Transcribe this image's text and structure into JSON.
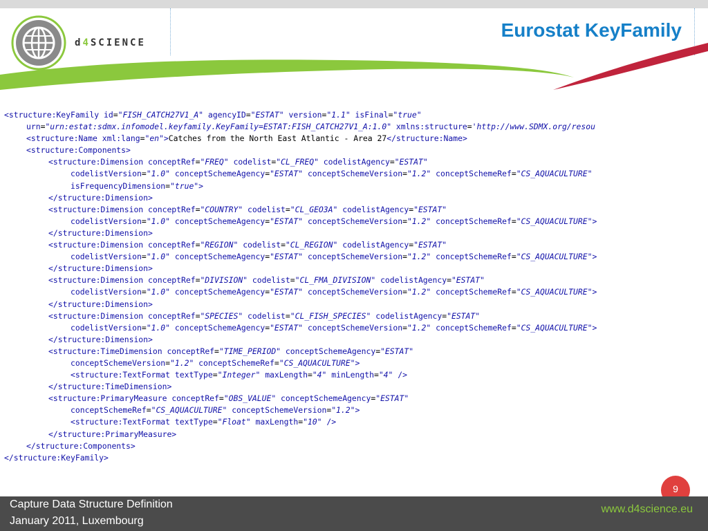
{
  "header": {
    "title": "Eurostat KeyFamily",
    "logo_prefix": "d",
    "logo_digit": "4",
    "logo_suffix": "SCIENCE"
  },
  "code_lines": [
    {
      "indent": 0,
      "tokens": [
        [
          "tg",
          "<structure:KeyFamily"
        ],
        [
          "tx",
          " "
        ],
        [
          "at",
          "id"
        ],
        [
          "eq",
          "="
        ],
        [
          "vl",
          "\"FISH_CATCH27V1_A\""
        ],
        [
          "tx",
          " "
        ],
        [
          "at",
          "agencyID"
        ],
        [
          "eq",
          "="
        ],
        [
          "vl",
          "\"ESTAT\""
        ],
        [
          "tx",
          " "
        ],
        [
          "at",
          "version"
        ],
        [
          "eq",
          "="
        ],
        [
          "vl",
          "\"1.1\""
        ],
        [
          "tx",
          " "
        ],
        [
          "at",
          "isFinal"
        ],
        [
          "eq",
          "="
        ],
        [
          "vl",
          "\"true\""
        ]
      ]
    },
    {
      "indent": 1,
      "tokens": [
        [
          "at",
          "urn"
        ],
        [
          "eq",
          "="
        ],
        [
          "vl",
          "\"urn:estat:sdmx.infomodel.keyfamily.KeyFamily=ESTAT:FISH_CATCH27V1_A:1.0\""
        ],
        [
          "tx",
          " "
        ],
        [
          "at",
          "xmlns:structure"
        ],
        [
          "eq",
          "="
        ],
        [
          "vl",
          "'http://www.SDMX.org/resou"
        ]
      ]
    },
    {
      "indent": 1,
      "tokens": [
        [
          "tg",
          "<structure:Name"
        ],
        [
          "tx",
          " "
        ],
        [
          "at",
          "xml:lang"
        ],
        [
          "eq",
          "="
        ],
        [
          "vl",
          "\"en\""
        ],
        [
          "tg",
          ">"
        ],
        [
          "tx",
          "Catches from the North East Atlantic - Area 27"
        ],
        [
          "tg",
          "</structure:Name>"
        ]
      ]
    },
    {
      "indent": 1,
      "tokens": [
        [
          "tg",
          "<structure:Components>"
        ]
      ]
    },
    {
      "indent": 2,
      "tokens": [
        [
          "tg",
          "<structure:Dimension"
        ],
        [
          "tx",
          " "
        ],
        [
          "at",
          "conceptRef"
        ],
        [
          "eq",
          "="
        ],
        [
          "vl",
          "\"FREQ\""
        ],
        [
          "tx",
          " "
        ],
        [
          "at",
          "codelist"
        ],
        [
          "eq",
          "="
        ],
        [
          "vl",
          "\"CL_FREQ\""
        ],
        [
          "tx",
          " "
        ],
        [
          "at",
          "codelistAgency"
        ],
        [
          "eq",
          "="
        ],
        [
          "vl",
          "\"ESTAT\""
        ]
      ]
    },
    {
      "indent": 3,
      "tokens": [
        [
          "at",
          "codelistVersion"
        ],
        [
          "eq",
          "="
        ],
        [
          "vl",
          "\"1.0\""
        ],
        [
          "tx",
          " "
        ],
        [
          "at",
          "conceptSchemeAgency"
        ],
        [
          "eq",
          "="
        ],
        [
          "vl",
          "\"ESTAT\""
        ],
        [
          "tx",
          " "
        ],
        [
          "at",
          "conceptSchemeVersion"
        ],
        [
          "eq",
          "="
        ],
        [
          "vl",
          "\"1.2\""
        ],
        [
          "tx",
          " "
        ],
        [
          "at",
          "conceptSchemeRef"
        ],
        [
          "eq",
          "="
        ],
        [
          "vl",
          "\"CS_AQUACULTURE\""
        ]
      ]
    },
    {
      "indent": 3,
      "tokens": [
        [
          "at",
          "isFrequencyDimension"
        ],
        [
          "eq",
          "="
        ],
        [
          "vl",
          "\"true\""
        ],
        [
          "tg",
          ">"
        ]
      ]
    },
    {
      "indent": 2,
      "tokens": [
        [
          "tg",
          "</structure:Dimension>"
        ]
      ]
    },
    {
      "indent": 2,
      "tokens": [
        [
          "tg",
          "<structure:Dimension"
        ],
        [
          "tx",
          " "
        ],
        [
          "at",
          "conceptRef"
        ],
        [
          "eq",
          "="
        ],
        [
          "vl",
          "\"COUNTRY\""
        ],
        [
          "tx",
          " "
        ],
        [
          "at",
          "codelist"
        ],
        [
          "eq",
          "="
        ],
        [
          "vl",
          "\"CL_GEO3A\""
        ],
        [
          "tx",
          " "
        ],
        [
          "at",
          "codelistAgency"
        ],
        [
          "eq",
          "="
        ],
        [
          "vl",
          "\"ESTAT\""
        ]
      ]
    },
    {
      "indent": 3,
      "tokens": [
        [
          "at",
          "codelistVersion"
        ],
        [
          "eq",
          "="
        ],
        [
          "vl",
          "\"1.0\""
        ],
        [
          "tx",
          " "
        ],
        [
          "at",
          "conceptSchemeAgency"
        ],
        [
          "eq",
          "="
        ],
        [
          "vl",
          "\"ESTAT\""
        ],
        [
          "tx",
          " "
        ],
        [
          "at",
          "conceptSchemeVersion"
        ],
        [
          "eq",
          "="
        ],
        [
          "vl",
          "\"1.2\""
        ],
        [
          "tx",
          " "
        ],
        [
          "at",
          "conceptSchemeRef"
        ],
        [
          "eq",
          "="
        ],
        [
          "vl",
          "\"CS_AQUACULTURE\""
        ],
        [
          "tg",
          ">"
        ]
      ]
    },
    {
      "indent": 2,
      "tokens": [
        [
          "tg",
          "</structure:Dimension>"
        ]
      ]
    },
    {
      "indent": 2,
      "tokens": [
        [
          "tg",
          "<structure:Dimension"
        ],
        [
          "tx",
          " "
        ],
        [
          "at",
          "conceptRef"
        ],
        [
          "eq",
          "="
        ],
        [
          "vl",
          "\"REGION\""
        ],
        [
          "tx",
          " "
        ],
        [
          "at",
          "codelist"
        ],
        [
          "eq",
          "="
        ],
        [
          "vl",
          "\"CL_REGION\""
        ],
        [
          "tx",
          " "
        ],
        [
          "at",
          "codelistAgency"
        ],
        [
          "eq",
          "="
        ],
        [
          "vl",
          "\"ESTAT\""
        ]
      ]
    },
    {
      "indent": 3,
      "tokens": [
        [
          "at",
          "codelistVersion"
        ],
        [
          "eq",
          "="
        ],
        [
          "vl",
          "\"1.0\""
        ],
        [
          "tx",
          " "
        ],
        [
          "at",
          "conceptSchemeAgency"
        ],
        [
          "eq",
          "="
        ],
        [
          "vl",
          "\"ESTAT\""
        ],
        [
          "tx",
          " "
        ],
        [
          "at",
          "conceptSchemeVersion"
        ],
        [
          "eq",
          "="
        ],
        [
          "vl",
          "\"1.2\""
        ],
        [
          "tx",
          " "
        ],
        [
          "at",
          "conceptSchemeRef"
        ],
        [
          "eq",
          "="
        ],
        [
          "vl",
          "\"CS_AQUACULTURE\""
        ],
        [
          "tg",
          ">"
        ]
      ]
    },
    {
      "indent": 2,
      "tokens": [
        [
          "tg",
          "</structure:Dimension>"
        ]
      ]
    },
    {
      "indent": 2,
      "tokens": [
        [
          "tg",
          "<structure:Dimension"
        ],
        [
          "tx",
          " "
        ],
        [
          "at",
          "conceptRef"
        ],
        [
          "eq",
          "="
        ],
        [
          "vl",
          "\"DIVISION\""
        ],
        [
          "tx",
          " "
        ],
        [
          "at",
          "codelist"
        ],
        [
          "eq",
          "="
        ],
        [
          "vl",
          "\"CL_FMA_DIVISION\""
        ],
        [
          "tx",
          " "
        ],
        [
          "at",
          "codelistAgency"
        ],
        [
          "eq",
          "="
        ],
        [
          "vl",
          "\"ESTAT\""
        ]
      ]
    },
    {
      "indent": 3,
      "tokens": [
        [
          "at",
          "codelistVersion"
        ],
        [
          "eq",
          "="
        ],
        [
          "vl",
          "\"1.0\""
        ],
        [
          "tx",
          " "
        ],
        [
          "at",
          "conceptSchemeAgency"
        ],
        [
          "eq",
          "="
        ],
        [
          "vl",
          "\"ESTAT\""
        ],
        [
          "tx",
          " "
        ],
        [
          "at",
          "conceptSchemeVersion"
        ],
        [
          "eq",
          "="
        ],
        [
          "vl",
          "\"1.2\""
        ],
        [
          "tx",
          " "
        ],
        [
          "at",
          "conceptSchemeRef"
        ],
        [
          "eq",
          "="
        ],
        [
          "vl",
          "\"CS_AQUACULTURE\""
        ],
        [
          "tg",
          ">"
        ]
      ]
    },
    {
      "indent": 2,
      "tokens": [
        [
          "tg",
          "</structure:Dimension>"
        ]
      ]
    },
    {
      "indent": 2,
      "tokens": [
        [
          "tg",
          "<structure:Dimension"
        ],
        [
          "tx",
          " "
        ],
        [
          "at",
          "conceptRef"
        ],
        [
          "eq",
          "="
        ],
        [
          "vl",
          "\"SPECIES\""
        ],
        [
          "tx",
          " "
        ],
        [
          "at",
          "codelist"
        ],
        [
          "eq",
          "="
        ],
        [
          "vl",
          "\"CL_FISH_SPECIES\""
        ],
        [
          "tx",
          " "
        ],
        [
          "at",
          "codelistAgency"
        ],
        [
          "eq",
          "="
        ],
        [
          "vl",
          "\"ESTAT\""
        ]
      ]
    },
    {
      "indent": 3,
      "tokens": [
        [
          "at",
          "codelistVersion"
        ],
        [
          "eq",
          "="
        ],
        [
          "vl",
          "\"1.0\""
        ],
        [
          "tx",
          " "
        ],
        [
          "at",
          "conceptSchemeAgency"
        ],
        [
          "eq",
          "="
        ],
        [
          "vl",
          "\"ESTAT\""
        ],
        [
          "tx",
          " "
        ],
        [
          "at",
          "conceptSchemeVersion"
        ],
        [
          "eq",
          "="
        ],
        [
          "vl",
          "\"1.2\""
        ],
        [
          "tx",
          " "
        ],
        [
          "at",
          "conceptSchemeRef"
        ],
        [
          "eq",
          "="
        ],
        [
          "vl",
          "\"CS_AQUACULTURE\""
        ],
        [
          "tg",
          ">"
        ]
      ]
    },
    {
      "indent": 2,
      "tokens": [
        [
          "tg",
          "</structure:Dimension>"
        ]
      ]
    },
    {
      "indent": 2,
      "tokens": [
        [
          "tg",
          "<structure:TimeDimension"
        ],
        [
          "tx",
          " "
        ],
        [
          "at",
          "conceptRef"
        ],
        [
          "eq",
          "="
        ],
        [
          "vl",
          "\"TIME_PERIOD\""
        ],
        [
          "tx",
          " "
        ],
        [
          "at",
          "conceptSchemeAgency"
        ],
        [
          "eq",
          "="
        ],
        [
          "vl",
          "\"ESTAT\""
        ]
      ]
    },
    {
      "indent": 3,
      "tokens": [
        [
          "at",
          "conceptSchemeVersion"
        ],
        [
          "eq",
          "="
        ],
        [
          "vl",
          "\"1.2\""
        ],
        [
          "tx",
          " "
        ],
        [
          "at",
          "conceptSchemeRef"
        ],
        [
          "eq",
          "="
        ],
        [
          "vl",
          "\"CS_AQUACULTURE\""
        ],
        [
          "tg",
          ">"
        ]
      ]
    },
    {
      "indent": 3,
      "tokens": [
        [
          "tg",
          "<structure:TextFormat"
        ],
        [
          "tx",
          " "
        ],
        [
          "at",
          "textType"
        ],
        [
          "eq",
          "="
        ],
        [
          "vl",
          "\"Integer\""
        ],
        [
          "tx",
          " "
        ],
        [
          "at",
          "maxLength"
        ],
        [
          "eq",
          "="
        ],
        [
          "vl",
          "\"4\""
        ],
        [
          "tx",
          " "
        ],
        [
          "at",
          "minLength"
        ],
        [
          "eq",
          "="
        ],
        [
          "vl",
          "\"4\""
        ],
        [
          "tx",
          " "
        ],
        [
          "tg",
          "/>"
        ]
      ]
    },
    {
      "indent": 2,
      "tokens": [
        [
          "tg",
          "</structure:TimeDimension>"
        ]
      ]
    },
    {
      "indent": 2,
      "tokens": [
        [
          "tg",
          "<structure:PrimaryMeasure"
        ],
        [
          "tx",
          " "
        ],
        [
          "at",
          "conceptRef"
        ],
        [
          "eq",
          "="
        ],
        [
          "vl",
          "\"OBS_VALUE\""
        ],
        [
          "tx",
          " "
        ],
        [
          "at",
          "conceptSchemeAgency"
        ],
        [
          "eq",
          "="
        ],
        [
          "vl",
          "\"ESTAT\""
        ]
      ]
    },
    {
      "indent": 3,
      "tokens": [
        [
          "at",
          "conceptSchemeRef"
        ],
        [
          "eq",
          "="
        ],
        [
          "vl",
          "\"CS_AQUACULTURE\""
        ],
        [
          "tx",
          " "
        ],
        [
          "at",
          "conceptSchemeVersion"
        ],
        [
          "eq",
          "="
        ],
        [
          "vl",
          "\"1.2\""
        ],
        [
          "tg",
          ">"
        ]
      ]
    },
    {
      "indent": 3,
      "tokens": [
        [
          "tg",
          "<structure:TextFormat"
        ],
        [
          "tx",
          " "
        ],
        [
          "at",
          "textType"
        ],
        [
          "eq",
          "="
        ],
        [
          "vl",
          "\"Float\""
        ],
        [
          "tx",
          " "
        ],
        [
          "at",
          "maxLength"
        ],
        [
          "eq",
          "="
        ],
        [
          "vl",
          "\"10\""
        ],
        [
          "tx",
          " "
        ],
        [
          "tg",
          "/>"
        ]
      ]
    },
    {
      "indent": 2,
      "tokens": [
        [
          "tg",
          "</structure:PrimaryMeasure>"
        ]
      ]
    },
    {
      "indent": 1,
      "tokens": [
        [
          "tg",
          "</structure:Components>"
        ]
      ]
    },
    {
      "indent": 0,
      "tokens": [
        [
          "tg",
          "</structure:KeyFamily>"
        ]
      ]
    }
  ],
  "footer": {
    "line1": "Capture Data Structure Definition",
    "line2": "January 2011, Luxembourg",
    "url": "www.d4science.eu",
    "page_number": "9"
  },
  "colors": {
    "title": "#1680c8",
    "brand_green": "#8bc83d",
    "accent_red": "#c0243c",
    "footer_bg": "#4b4b4b",
    "xml_markup": "#1010a8"
  }
}
